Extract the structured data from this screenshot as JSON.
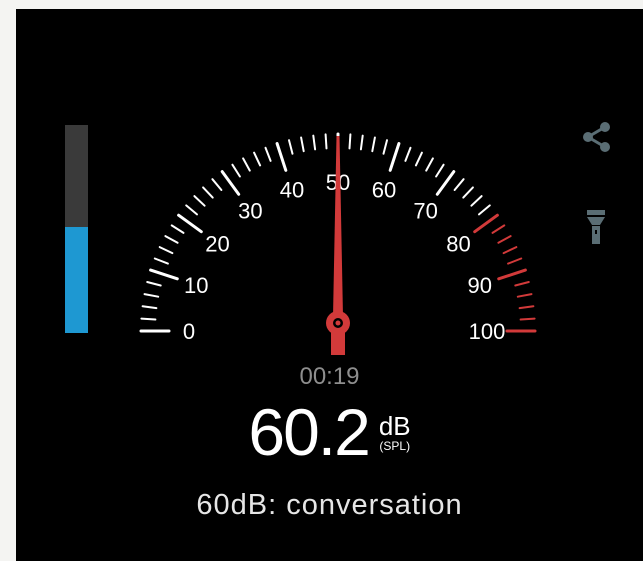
{
  "meter": {
    "scale_min": 0,
    "scale_max": 100,
    "scale_labels": [
      "0",
      "10",
      "20",
      "30",
      "40",
      "50",
      "60",
      "70",
      "80",
      "90",
      "100"
    ],
    "warning_from": 80,
    "needle_value": 50,
    "level_fraction": 0.51
  },
  "timer": "00:19",
  "reading": {
    "value": "60.2",
    "unit": "dB",
    "unit_sub": "(SPL)"
  },
  "description": "60dB: conversation",
  "icons": {
    "share": "share-icon",
    "flashlight": "flashlight-icon"
  },
  "colors": {
    "background": "#000000",
    "level_fill": "#1e98d2",
    "level_track": "#3a3a3a",
    "needle": "#d23a3a",
    "warning_ticks": "#d23a3a",
    "ticks": "#ffffff",
    "icons": "#5a6d74"
  }
}
